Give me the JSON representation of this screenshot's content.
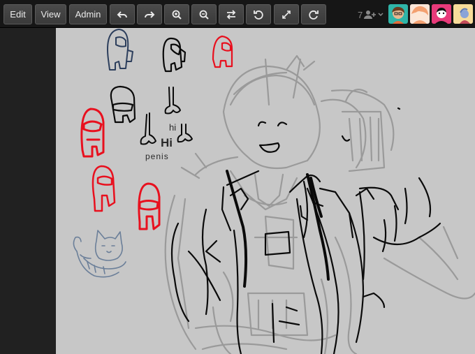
{
  "toolbar": {
    "edit_label": "Edit",
    "view_label": "View",
    "admin_label": "Admin",
    "icons": [
      "undo-icon",
      "redo-icon",
      "zoom-in-icon",
      "zoom-out-icon",
      "flip-icon",
      "rotate-left-icon",
      "fullscreen-icon",
      "rotate-right-icon"
    ]
  },
  "users": {
    "count": "7",
    "icon": "add-user-icon",
    "avatar_colors": [
      "#2fb5a8",
      "#f0a078",
      "#e83a7a",
      "#f2c46a"
    ]
  },
  "canvas": {
    "background": "#c7c7c7",
    "doodles": {
      "hi_small": "hi",
      "hi_large": "Hi",
      "scribble_word": "penis"
    }
  },
  "colors": {
    "stroke_red": "#e8101e",
    "stroke_black": "#0a0a0a",
    "stroke_navy": "#2c3e5c",
    "stroke_gray": "#9a9a9a",
    "stroke_blue_gray": "#6b7f99"
  }
}
